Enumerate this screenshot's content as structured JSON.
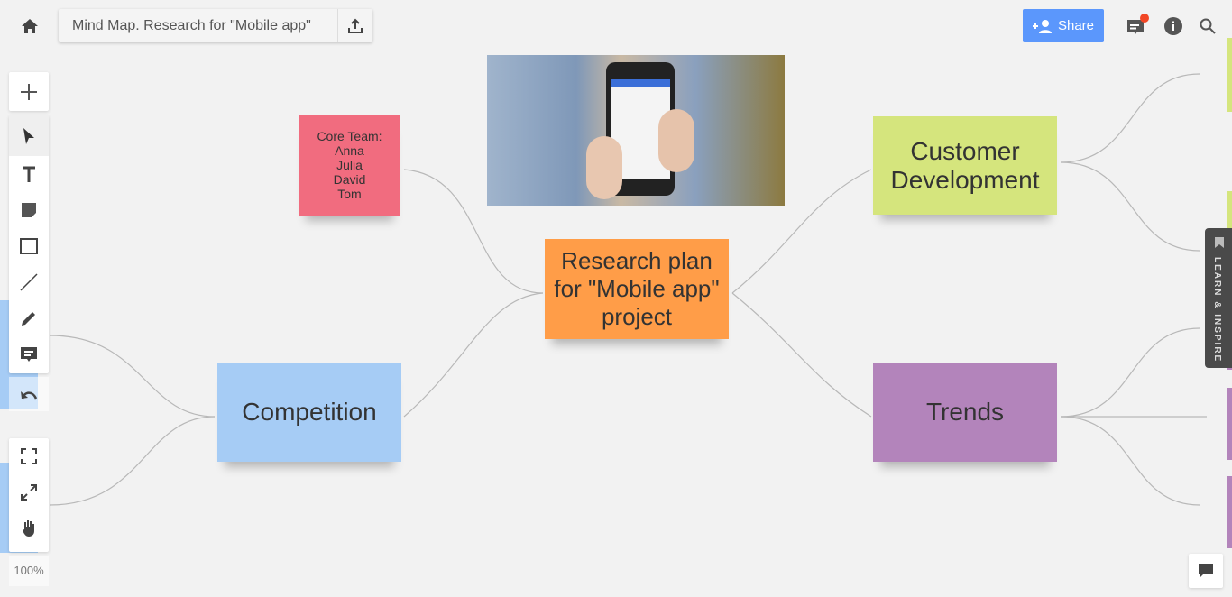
{
  "header": {
    "board_title": "Mind Map. Research for \"Mobile app\"",
    "share_label": "Share",
    "has_notification": true
  },
  "toolbar": {
    "zoom_level": "100%"
  },
  "side_tab": {
    "label": "LEARN & INSPIRE"
  },
  "board": {
    "center": "Research plan for \"Mobile app\" project",
    "note_core_team": [
      "Core Team:",
      "Anna",
      "Julia",
      "David",
      "Tom"
    ],
    "customer_development": "Customer Development",
    "trends": "Trends",
    "competition": "Competition"
  },
  "colors": {
    "accent": "#5b97fc",
    "orange": "#ff9d48",
    "green": "#d5e57d",
    "purple": "#b384bb",
    "blue": "#a6ccf5",
    "pink": "#f16c7f",
    "notification": "#f24726"
  }
}
